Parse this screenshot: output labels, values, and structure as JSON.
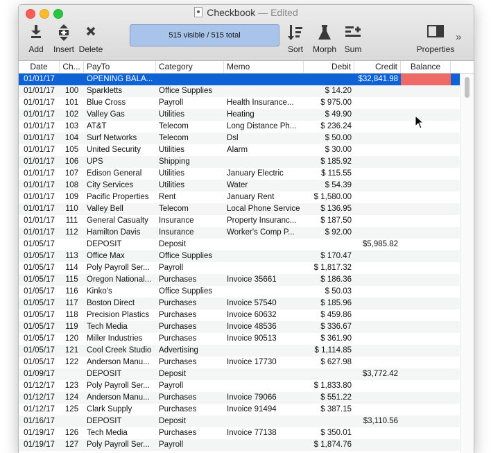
{
  "window": {
    "title": "Checkbook",
    "separator": "—",
    "state": "Edited"
  },
  "toolbar": {
    "add": "Add",
    "insert": "Insert",
    "delete": "Delete",
    "status": "515 visible / 515 total",
    "sort": "Sort",
    "morph": "Morph",
    "sum": "Sum",
    "properties": "Properties",
    "more": "»"
  },
  "columns": [
    "Date",
    "Ch...",
    "PayTo",
    "Category",
    "Memo",
    "Debit",
    "Credit",
    "Balance"
  ],
  "rows": [
    [
      "01/01/17",
      "",
      "OPENING BALA...",
      "",
      "",
      "",
      "$32,841.98"
    ],
    [
      "01/01/17",
      "100",
      "Sparkletts",
      "Office Supplies",
      "",
      "$ 14.20",
      ""
    ],
    [
      "01/01/17",
      "101",
      "Blue Cross",
      "Payroll",
      "Health Insurance...",
      "$ 975.00",
      ""
    ],
    [
      "01/01/17",
      "102",
      "Valley Gas",
      "Utilities",
      "Heating",
      "$ 49.90",
      ""
    ],
    [
      "01/01/17",
      "103",
      "AT&T",
      "Telecom",
      "Long Distance Ph...",
      "$ 236.24",
      ""
    ],
    [
      "01/01/17",
      "104",
      "Surf Networks",
      "Telecom",
      "Dsl",
      "$ 50.00",
      ""
    ],
    [
      "01/01/17",
      "105",
      "United Security",
      "Utilities",
      "Alarm",
      "$ 30.00",
      ""
    ],
    [
      "01/01/17",
      "106",
      "UPS",
      "Shipping",
      "",
      "$ 185.92",
      ""
    ],
    [
      "01/01/17",
      "107",
      "Edison General",
      "Utilities",
      "January Electric",
      "$ 115.55",
      ""
    ],
    [
      "01/01/17",
      "108",
      "City Services",
      "Utilities",
      "Water",
      "$ 54.39",
      ""
    ],
    [
      "01/01/17",
      "109",
      "Pacific Properties",
      "Rent",
      "January Rent",
      "$ 1,580.00",
      ""
    ],
    [
      "01/01/17",
      "110",
      "Valley Bell",
      "Telecom",
      "Local Phone Service",
      "$ 136.95",
      ""
    ],
    [
      "01/01/17",
      "111",
      "General Casualty",
      "Insurance",
      "Property Insuranc...",
      "$ 187.50",
      ""
    ],
    [
      "01/01/17",
      "112",
      "Hamilton Davis",
      "Insurance",
      "Worker's Comp P...",
      "$ 92.00",
      ""
    ],
    [
      "01/05/17",
      "",
      "DEPOSIT",
      "Deposit",
      "",
      "",
      "$5,985.82"
    ],
    [
      "01/05/17",
      "113",
      "Office Max",
      "Office Supplies",
      "",
      "$ 170.47",
      ""
    ],
    [
      "01/05/17",
      "114",
      "Poly Payroll Ser...",
      "Payroll",
      "",
      "$ 1,817.32",
      ""
    ],
    [
      "01/05/17",
      "115",
      "Oregon National...",
      "Purchases",
      "Invoice 35661",
      "$ 186.36",
      ""
    ],
    [
      "01/05/17",
      "116",
      "Kinko's",
      "Office Supplies",
      "",
      "$ 50.03",
      ""
    ],
    [
      "01/05/17",
      "117",
      "Boston Direct",
      "Purchases",
      "Invoice 57540",
      "$ 185.96",
      ""
    ],
    [
      "01/05/17",
      "118",
      "Precision Plastics",
      "Purchases",
      "Invoice 60632",
      "$ 459.86",
      ""
    ],
    [
      "01/05/17",
      "119",
      "Tech Media",
      "Purchases",
      "Invoice 48536",
      "$ 336.67",
      ""
    ],
    [
      "01/05/17",
      "120",
      "Miller Industries",
      "Purchases",
      "Invoice 90513",
      "$ 361.90",
      ""
    ],
    [
      "01/05/17",
      "121",
      "Cool Creek Studio",
      "Advertising",
      "",
      "$ 1,114.85",
      ""
    ],
    [
      "01/05/17",
      "122",
      "Anderson Manu...",
      "Purchases",
      "Invoice 17730",
      "$ 627.98",
      ""
    ],
    [
      "01/09/17",
      "",
      "DEPOSIT",
      "Deposit",
      "",
      "",
      "$3,772.42"
    ],
    [
      "01/12/17",
      "123",
      "Poly Payroll Ser...",
      "Payroll",
      "",
      "$ 1,833.80",
      ""
    ],
    [
      "01/12/17",
      "124",
      "Anderson Manu...",
      "Purchases",
      "Invoice 79066",
      "$ 551.22",
      ""
    ],
    [
      "01/12/17",
      "125",
      "Clark Supply",
      "Purchases",
      "Invoice 91494",
      "$ 387.15",
      ""
    ],
    [
      "01/16/17",
      "",
      "DEPOSIT",
      "Deposit",
      "",
      "",
      "$3,110.56"
    ],
    [
      "01/19/17",
      "126",
      "Tech Media",
      "Purchases",
      "Invoice 77138",
      "$ 350.01",
      ""
    ],
    [
      "01/19/17",
      "127",
      "Poly Payroll Ser...",
      "Payroll",
      "",
      "$ 1,874.76",
      ""
    ]
  ],
  "selected_row": 0,
  "colors": {
    "selection": "#0d63d6",
    "balance_bar": "#ee6a66",
    "status_bg": "#a9c4ea"
  }
}
